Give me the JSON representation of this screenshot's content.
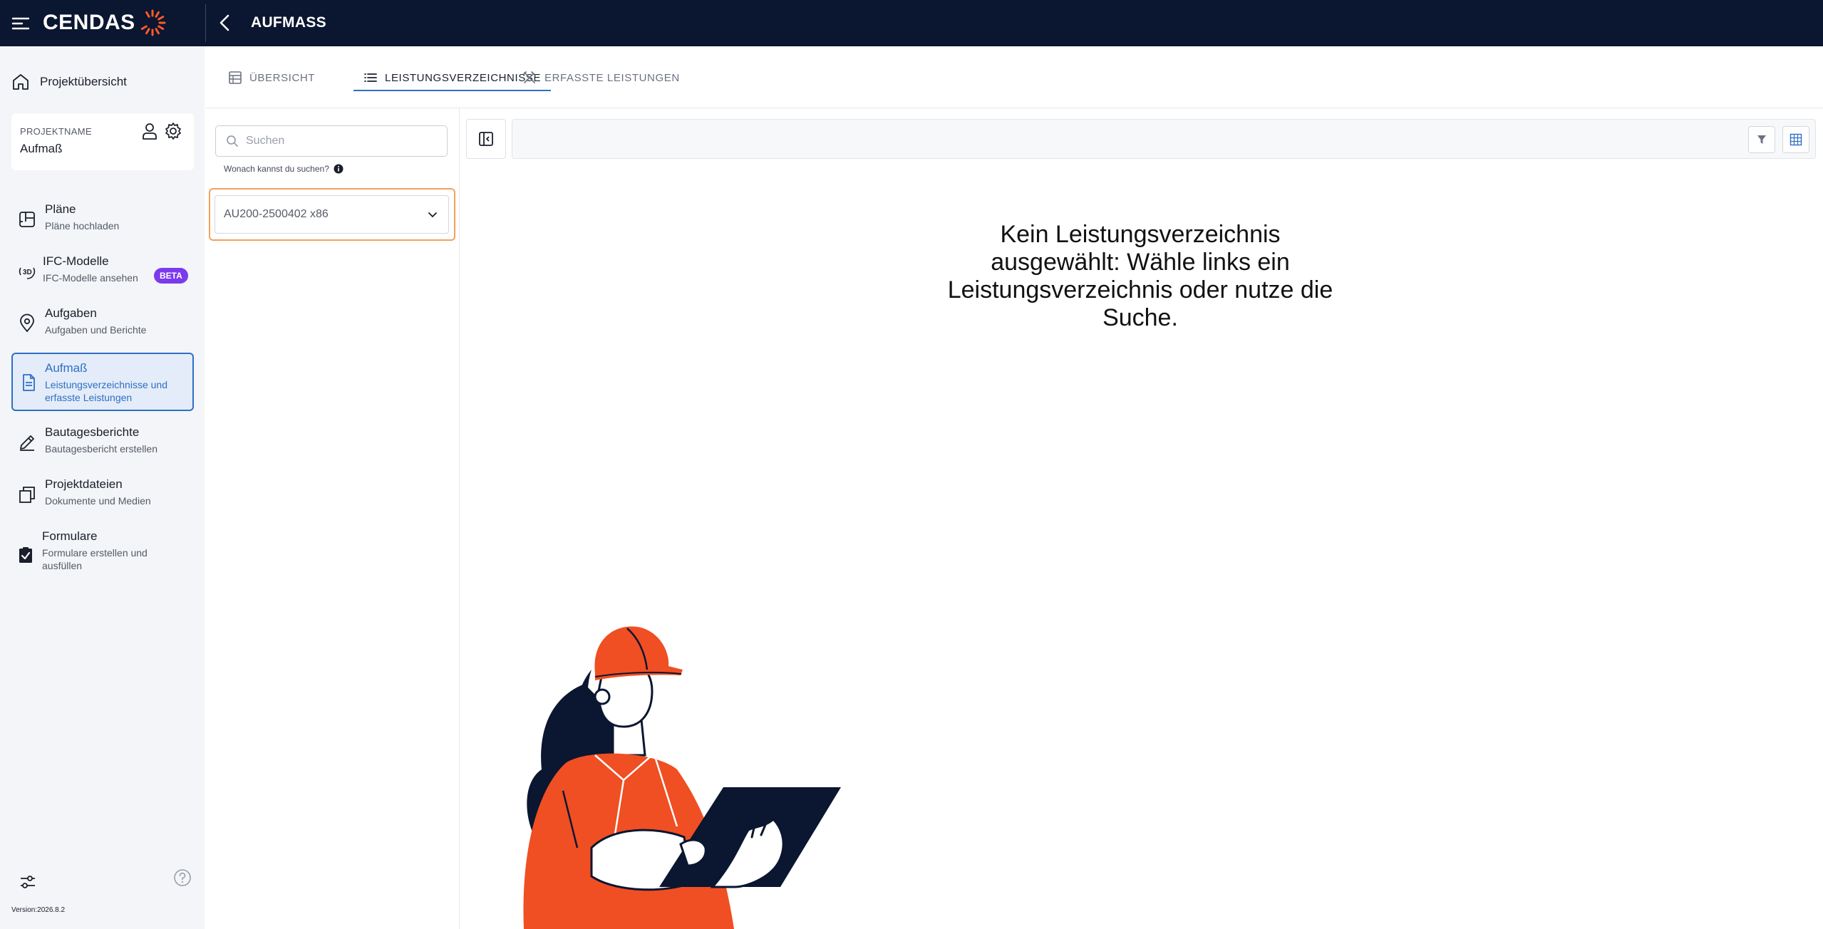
{
  "topbar": {
    "logo": "CENDAS",
    "title": "AUFMASS"
  },
  "sidebar": {
    "overview": "Projektübersicht",
    "project": {
      "label": "PROJEKTNAME",
      "name": "Aufmaß"
    },
    "items": [
      {
        "title": "Pläne",
        "subtitle": "Pläne hochladen",
        "icon": "plans-icon"
      },
      {
        "title": "IFC-Modelle",
        "subtitle": "IFC-Modelle ansehen",
        "icon": "3d-icon",
        "badge": "BETA"
      },
      {
        "title": "Aufgaben",
        "subtitle": "Aufgaben und Berichte",
        "icon": "location-pin-icon"
      },
      {
        "title": "Aufmaß",
        "subtitle": "Leistungsverzeichnisse und erfasste Leistungen",
        "icon": "document-icon",
        "active": true
      },
      {
        "title": "Bautagesberichte",
        "subtitle": "Bautagesbericht erstellen",
        "icon": "pencil-icon"
      },
      {
        "title": "Projektdateien",
        "subtitle": "Dokumente und Medien",
        "icon": "files-icon"
      },
      {
        "title": "Formulare",
        "subtitle": "Formulare erstellen und ausfüllen",
        "icon": "clipboard-check-icon"
      }
    ],
    "version": "Version:2026.8.2"
  },
  "tabs": [
    {
      "label": "ÜBERSICHT",
      "icon": "table-icon"
    },
    {
      "label": "LEISTUNGSVERZEICHNISSE",
      "icon": "list-icon",
      "active": true
    },
    {
      "label": "ERFASSTE LEISTUNGEN",
      "icon": "tools-icon"
    }
  ],
  "search": {
    "placeholder": "Suchen",
    "hint": "Wonach kannst du suchen?"
  },
  "lv_select": {
    "value": "AU200-2500402 x86"
  },
  "main": {
    "empty_message": "Kein Leistungsverzeichnis ausgewählt: Wähle links ein Leistungsverzeichnis oder nutze die Suche."
  },
  "colors": {
    "topbar": "#0b1630",
    "accent": "#2f6fc4",
    "highlight": "#f2a25c",
    "beta": "#7c3aed",
    "illustration_orange": "#f04e23"
  }
}
